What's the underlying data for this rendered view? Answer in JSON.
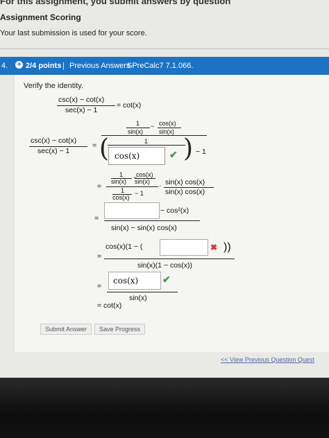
{
  "header": {
    "top_line": "For this assignment, you submit answers by question",
    "scoring_title": "Assignment Scoring",
    "scoring_text": "Your last submission is used for your score."
  },
  "question_bar": {
    "number": "4.",
    "points": "2/4 points",
    "separator": "|",
    "previous_answers": "Previous Answers",
    "course_code": "SPreCalc7 7.1.066."
  },
  "prompt": "Verify the identity.",
  "identity": {
    "lhs_num": "csc(x) − cot(x)",
    "lhs_den": "sec(x) − 1",
    "rhs": "= cot(x)"
  },
  "step1": {
    "lhs_num": "csc(x) − cot(x)",
    "lhs_den": "sec(x) − 1",
    "eq": "=",
    "one": "1",
    "sin": "sin(x)",
    "minus": "−",
    "cos": "cos(x)",
    "minus_one": "− 1",
    "answer": "cos(x)"
  },
  "step2": {
    "eq": "=",
    "one": "1",
    "sin": "sin(x)",
    "cos": "cos(x)",
    "minus": "−",
    "minus_one": "− 1",
    "dot": "·",
    "mult_num": "sin(x) cos(x)",
    "mult_den": "sin(x) cos(x)"
  },
  "step3": {
    "eq": "=",
    "after_box": "− cos²(x)",
    "den": "sin(x) − sin(x) cos(x)",
    "answer": ""
  },
  "step4": {
    "eq": "=",
    "prefix": "cos(x)(1 − (",
    "suffix": "))",
    "den": "sin(x)(1 − cos(x))",
    "answer": ""
  },
  "step5": {
    "eq": "=",
    "answer": "cos(x)",
    "den": "sin(x)"
  },
  "step6": {
    "text": "= cot(x)"
  },
  "buttons": {
    "submit": "Submit Answer",
    "save": "Save Progress"
  },
  "footer": {
    "previous_question": "<< View Previous Question   Quest"
  },
  "colors": {
    "bar": "#1c73c4",
    "check": "#3a9e3a",
    "cross": "#d33333"
  },
  "icons": {
    "correct": "check-icon",
    "incorrect": "cross-icon",
    "points": "plus-circle-icon"
  }
}
